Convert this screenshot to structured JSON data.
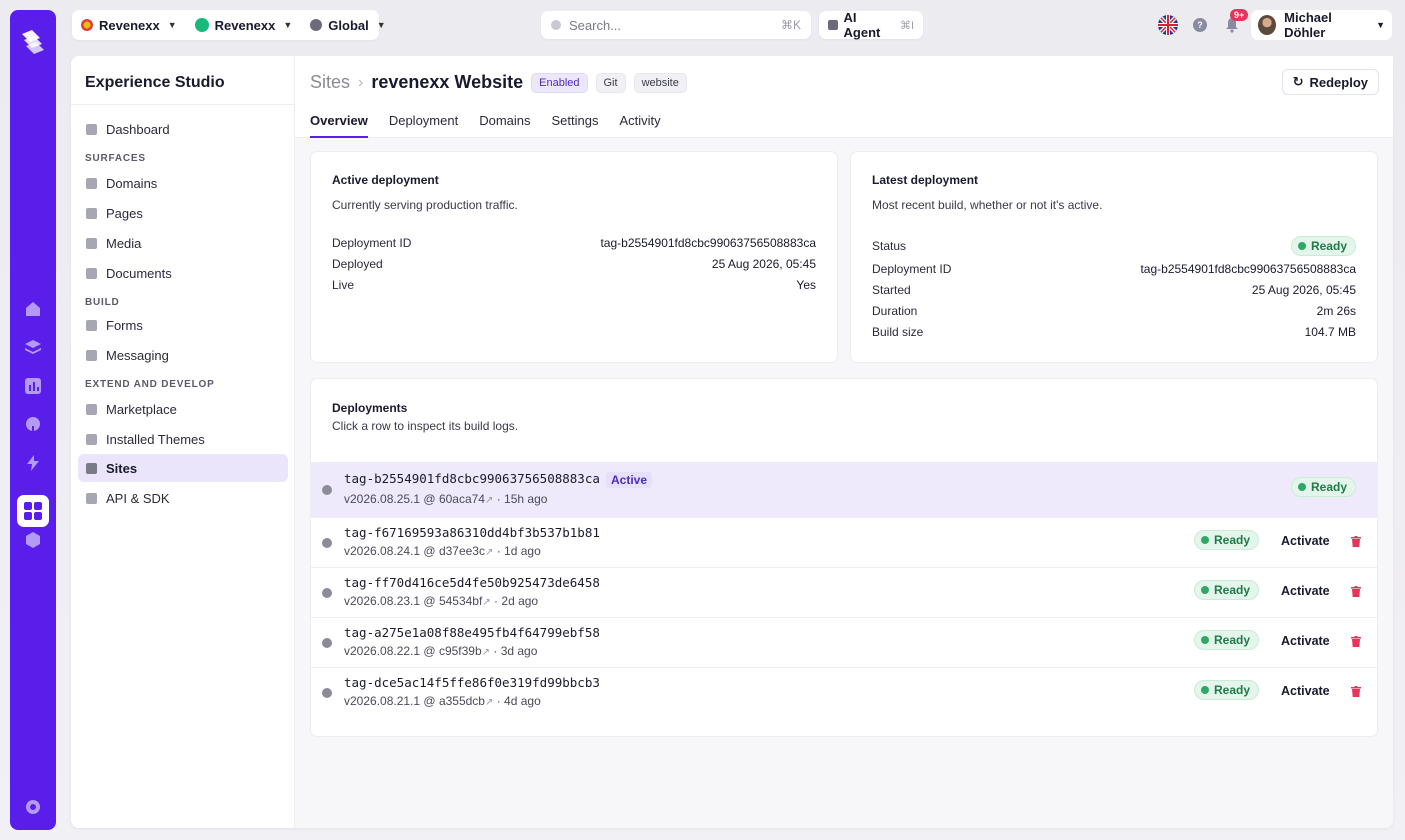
{
  "topbar": {
    "org_label": "Revenexx",
    "workspace_label": "Revenexx",
    "scope_label": "Global",
    "search_placeholder": "Search...",
    "search_shortcut": "⌘K",
    "ai_label": "AI Agent",
    "ai_shortcut": "⌘I",
    "notifications_count": "9+",
    "user_name": "Michael Döhler"
  },
  "sidebar": {
    "title": "Experience Studio",
    "items": [
      {
        "label": "Dashboard"
      },
      {
        "label": "Domains"
      },
      {
        "label": "Pages"
      },
      {
        "label": "Media"
      },
      {
        "label": "Documents"
      },
      {
        "label": "Forms"
      },
      {
        "label": "Messaging"
      },
      {
        "label": "Marketplace"
      },
      {
        "label": "Installed Themes"
      },
      {
        "label": "Sites"
      },
      {
        "label": "API & SDK"
      }
    ],
    "sections": [
      "SURFACES",
      "BUILD",
      "EXTEND AND DEVELOP"
    ]
  },
  "header": {
    "breadcrumb_parent": "Sites",
    "title": "revenexx Website",
    "pills": [
      "Enabled",
      "Git",
      "website"
    ],
    "redeploy_label": "Redeploy",
    "tabs": [
      "Overview",
      "Deployment",
      "Domains",
      "Settings",
      "Activity"
    ]
  },
  "active_deployment": {
    "title": "Active deployment",
    "subtitle": "Currently serving production traffic.",
    "rows": [
      {
        "k": "Deployment ID",
        "v": "tag-b2554901fd8cbc99063756508883ca"
      },
      {
        "k": "Deployed",
        "v": "25 Aug 2026, 05:45"
      },
      {
        "k": "Live",
        "v": "Yes"
      }
    ]
  },
  "latest_deployment": {
    "title": "Latest deployment",
    "subtitle": "Most recent build, whether or not it's active.",
    "status_label": "Status",
    "status_value": "Ready",
    "rows": [
      {
        "k": "Deployment ID",
        "v": "tag-b2554901fd8cbc99063756508883ca"
      },
      {
        "k": "Started",
        "v": "25 Aug 2026, 05:45"
      },
      {
        "k": "Duration",
        "v": "2m 26s"
      },
      {
        "k": "Build size",
        "v": "104.7 MB"
      }
    ]
  },
  "deployments": {
    "title": "Deployments",
    "subtitle": "Click a row to inspect its build logs.",
    "active_badge": "Active",
    "activate_label": "Activate",
    "rows": [
      {
        "tag": "tag-b2554901fd8cbc99063756508883ca",
        "version": "v2026.08.25.1",
        "commit": "60aca74",
        "age": "15h ago",
        "status": "Ready"
      },
      {
        "tag": "tag-f67169593a86310dd4bf3b537b1b81",
        "version": "v2026.08.24.1",
        "commit": "d37ee3c",
        "age": "1d ago",
        "status": "Ready"
      },
      {
        "tag": "tag-ff70d416ce5d4fe50b925473de6458",
        "version": "v2026.08.23.1",
        "commit": "54534bf",
        "age": "2d ago",
        "status": "Ready"
      },
      {
        "tag": "tag-a275e1a08f88e495fb4f64799ebf58",
        "version": "v2026.08.22.1",
        "commit": "c95f39b",
        "age": "3d ago",
        "status": "Ready"
      },
      {
        "tag": "tag-dce5ac14f5ffe86f0e319fd99bbcb3",
        "version": "v2026.08.21.1",
        "commit": "a355dcb",
        "age": "4d ago",
        "status": "Ready"
      }
    ]
  },
  "colors": {
    "brand": "#5a1eea",
    "ready": "#2fa866",
    "danger": "#e5355a"
  }
}
